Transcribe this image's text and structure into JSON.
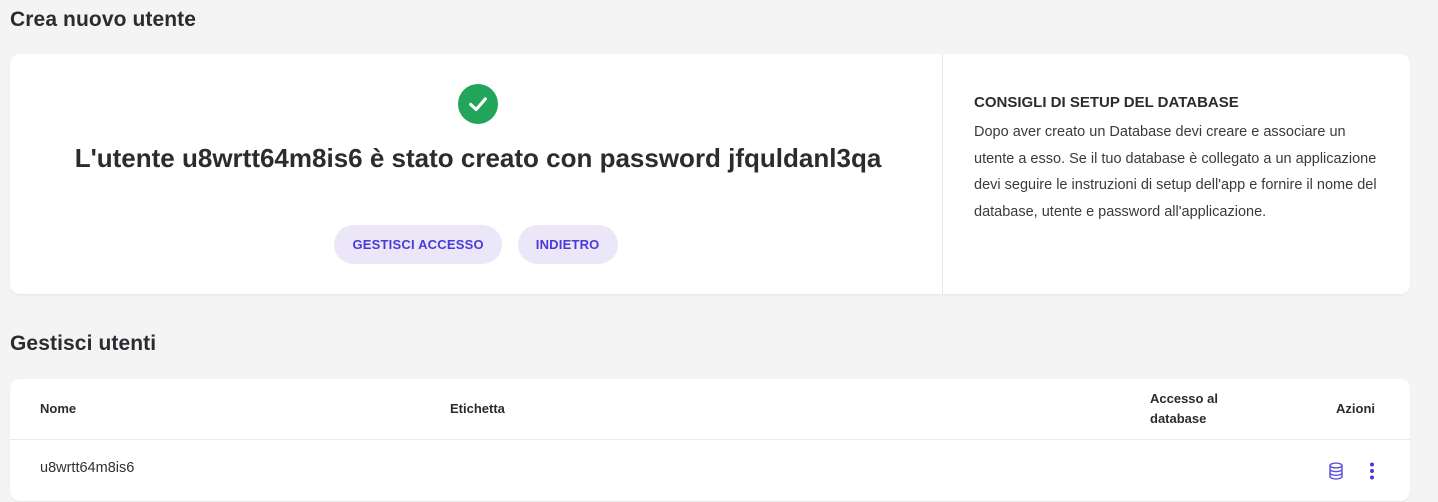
{
  "create_section": {
    "title": "Crea nuovo utente",
    "success_message": "L'utente u8wrtt64m8is6 è stato creato con password jfquldanl3qa",
    "status_icon": "check-circle-icon",
    "buttons": {
      "manage_access": "GESTISCI ACCESSO",
      "back": "INDIETRO"
    }
  },
  "tips": {
    "title": "CONSIGLI DI SETUP DEL DATABASE",
    "body": "Dopo aver creato un Database devi creare e associare un utente a esso. Se il tuo database è collegato a un applicazione devi seguire le instruzioni di setup dell'app e fornire il nome del database, utente e password all'applicazione."
  },
  "users_section": {
    "title": "Gestisci utenti",
    "columns": {
      "name": "Nome",
      "label": "Etichetta",
      "db_access": "Accesso al database",
      "actions": "Azioni"
    },
    "rows": [
      {
        "name": "u8wrtt64m8is6",
        "label": ""
      }
    ],
    "row_icons": [
      "database-icon",
      "more-vertical-icon"
    ]
  },
  "colors": {
    "accent": "#4a3bd6",
    "button_bg": "#ebe7f9",
    "success": "#22a55b",
    "page_bg": "#f4f4f5"
  }
}
